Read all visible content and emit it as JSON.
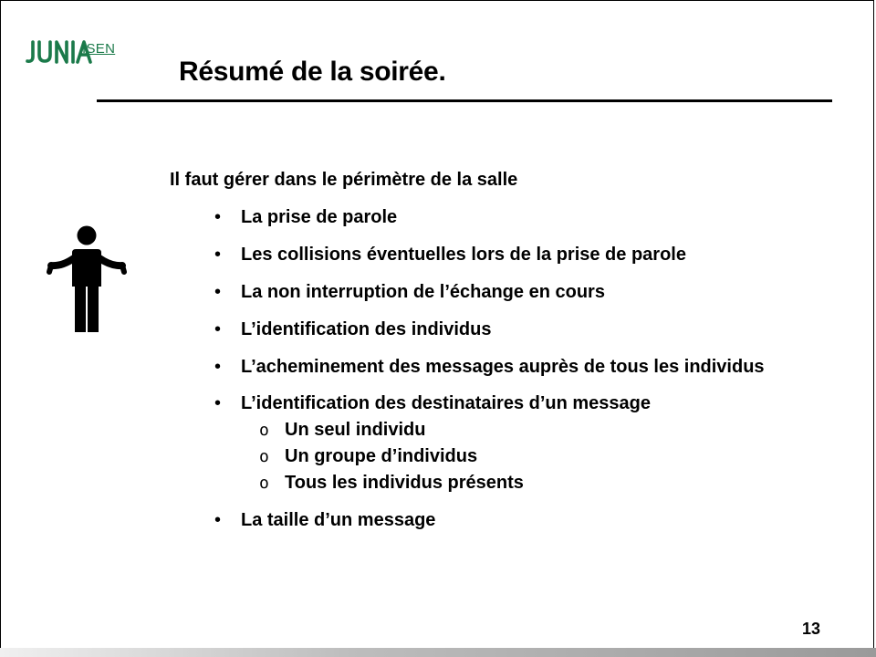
{
  "logo": {
    "brand": "JUNIA",
    "sub_brand": "ISEN",
    "brand_color": "#1b7a4a"
  },
  "title": "Résumé de la soirée.",
  "intro": "Il faut gérer dans le périmètre de la salle",
  "bullets": [
    {
      "text": "La prise de parole"
    },
    {
      "text": "Les collisions éventuelles lors de la prise de parole"
    },
    {
      "text": "La non interruption de l’échange en cours"
    },
    {
      "text": "L’identification des individus"
    },
    {
      "text": "L’acheminement des messages auprès de tous les individus"
    },
    {
      "text": "L’identification des destinataires d’un message",
      "subitems": [
        "Un seul individu",
        "Un groupe d’individus",
        "Tous les individus présents"
      ]
    },
    {
      "text": "La taille d’un message"
    }
  ],
  "page_number": "13",
  "icons": {
    "person": "person-shrug-icon"
  }
}
